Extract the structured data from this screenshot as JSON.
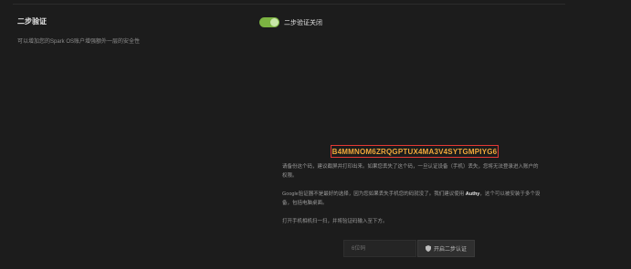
{
  "section": {
    "title": "二步验证",
    "description": "可以增加您的Spark OS账户增强额外一层的安全性"
  },
  "toggle": {
    "label": "二步验证关闭",
    "state": "on",
    "color": "#7cb342"
  },
  "secret": {
    "key": "B4MMNOM6ZRQGPTUX4MA3V4SYTGMPIYG6",
    "highlight_color": "#e53935",
    "text_color": "#f2a93b"
  },
  "instructions": {
    "p1": "请备份这个码，建议截屏并打印出来。如果您丢失了这个码，一旦认证设备（手机）丢失，您将无法登录进入账户的权限。",
    "p2_before": "Google验证器不是最好的选择，因为您如果丢失手机您的码就没了。我们建议使用 ",
    "p2_strong": "Authy",
    "p2_after": "，这个可以被安装于多个设备，包括电脑桌面。",
    "p3": "打开手机相机扫一扫，并将验证码输入至下方。"
  },
  "code_input": {
    "placeholder": "6位码",
    "value": ""
  },
  "enable_button": {
    "label": "开启二步认证",
    "icon": "shield-icon"
  }
}
